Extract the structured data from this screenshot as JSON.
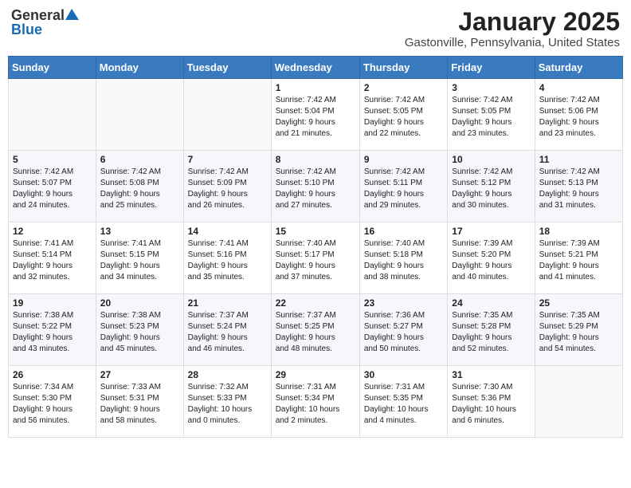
{
  "header": {
    "logo_general": "General",
    "logo_blue": "Blue",
    "month": "January 2025",
    "location": "Gastonville, Pennsylvania, United States"
  },
  "weekdays": [
    "Sunday",
    "Monday",
    "Tuesday",
    "Wednesday",
    "Thursday",
    "Friday",
    "Saturday"
  ],
  "weeks": [
    [
      {
        "day": "",
        "info": ""
      },
      {
        "day": "",
        "info": ""
      },
      {
        "day": "",
        "info": ""
      },
      {
        "day": "1",
        "info": "Sunrise: 7:42 AM\nSunset: 5:04 PM\nDaylight: 9 hours\nand 21 minutes."
      },
      {
        "day": "2",
        "info": "Sunrise: 7:42 AM\nSunset: 5:05 PM\nDaylight: 9 hours\nand 22 minutes."
      },
      {
        "day": "3",
        "info": "Sunrise: 7:42 AM\nSunset: 5:05 PM\nDaylight: 9 hours\nand 23 minutes."
      },
      {
        "day": "4",
        "info": "Sunrise: 7:42 AM\nSunset: 5:06 PM\nDaylight: 9 hours\nand 23 minutes."
      }
    ],
    [
      {
        "day": "5",
        "info": "Sunrise: 7:42 AM\nSunset: 5:07 PM\nDaylight: 9 hours\nand 24 minutes."
      },
      {
        "day": "6",
        "info": "Sunrise: 7:42 AM\nSunset: 5:08 PM\nDaylight: 9 hours\nand 25 minutes."
      },
      {
        "day": "7",
        "info": "Sunrise: 7:42 AM\nSunset: 5:09 PM\nDaylight: 9 hours\nand 26 minutes."
      },
      {
        "day": "8",
        "info": "Sunrise: 7:42 AM\nSunset: 5:10 PM\nDaylight: 9 hours\nand 27 minutes."
      },
      {
        "day": "9",
        "info": "Sunrise: 7:42 AM\nSunset: 5:11 PM\nDaylight: 9 hours\nand 29 minutes."
      },
      {
        "day": "10",
        "info": "Sunrise: 7:42 AM\nSunset: 5:12 PM\nDaylight: 9 hours\nand 30 minutes."
      },
      {
        "day": "11",
        "info": "Sunrise: 7:42 AM\nSunset: 5:13 PM\nDaylight: 9 hours\nand 31 minutes."
      }
    ],
    [
      {
        "day": "12",
        "info": "Sunrise: 7:41 AM\nSunset: 5:14 PM\nDaylight: 9 hours\nand 32 minutes."
      },
      {
        "day": "13",
        "info": "Sunrise: 7:41 AM\nSunset: 5:15 PM\nDaylight: 9 hours\nand 34 minutes."
      },
      {
        "day": "14",
        "info": "Sunrise: 7:41 AM\nSunset: 5:16 PM\nDaylight: 9 hours\nand 35 minutes."
      },
      {
        "day": "15",
        "info": "Sunrise: 7:40 AM\nSunset: 5:17 PM\nDaylight: 9 hours\nand 37 minutes."
      },
      {
        "day": "16",
        "info": "Sunrise: 7:40 AM\nSunset: 5:18 PM\nDaylight: 9 hours\nand 38 minutes."
      },
      {
        "day": "17",
        "info": "Sunrise: 7:39 AM\nSunset: 5:20 PM\nDaylight: 9 hours\nand 40 minutes."
      },
      {
        "day": "18",
        "info": "Sunrise: 7:39 AM\nSunset: 5:21 PM\nDaylight: 9 hours\nand 41 minutes."
      }
    ],
    [
      {
        "day": "19",
        "info": "Sunrise: 7:38 AM\nSunset: 5:22 PM\nDaylight: 9 hours\nand 43 minutes."
      },
      {
        "day": "20",
        "info": "Sunrise: 7:38 AM\nSunset: 5:23 PM\nDaylight: 9 hours\nand 45 minutes."
      },
      {
        "day": "21",
        "info": "Sunrise: 7:37 AM\nSunset: 5:24 PM\nDaylight: 9 hours\nand 46 minutes."
      },
      {
        "day": "22",
        "info": "Sunrise: 7:37 AM\nSunset: 5:25 PM\nDaylight: 9 hours\nand 48 minutes."
      },
      {
        "day": "23",
        "info": "Sunrise: 7:36 AM\nSunset: 5:27 PM\nDaylight: 9 hours\nand 50 minutes."
      },
      {
        "day": "24",
        "info": "Sunrise: 7:35 AM\nSunset: 5:28 PM\nDaylight: 9 hours\nand 52 minutes."
      },
      {
        "day": "25",
        "info": "Sunrise: 7:35 AM\nSunset: 5:29 PM\nDaylight: 9 hours\nand 54 minutes."
      }
    ],
    [
      {
        "day": "26",
        "info": "Sunrise: 7:34 AM\nSunset: 5:30 PM\nDaylight: 9 hours\nand 56 minutes."
      },
      {
        "day": "27",
        "info": "Sunrise: 7:33 AM\nSunset: 5:31 PM\nDaylight: 9 hours\nand 58 minutes."
      },
      {
        "day": "28",
        "info": "Sunrise: 7:32 AM\nSunset: 5:33 PM\nDaylight: 10 hours\nand 0 minutes."
      },
      {
        "day": "29",
        "info": "Sunrise: 7:31 AM\nSunset: 5:34 PM\nDaylight: 10 hours\nand 2 minutes."
      },
      {
        "day": "30",
        "info": "Sunrise: 7:31 AM\nSunset: 5:35 PM\nDaylight: 10 hours\nand 4 minutes."
      },
      {
        "day": "31",
        "info": "Sunrise: 7:30 AM\nSunset: 5:36 PM\nDaylight: 10 hours\nand 6 minutes."
      },
      {
        "day": "",
        "info": ""
      }
    ]
  ]
}
